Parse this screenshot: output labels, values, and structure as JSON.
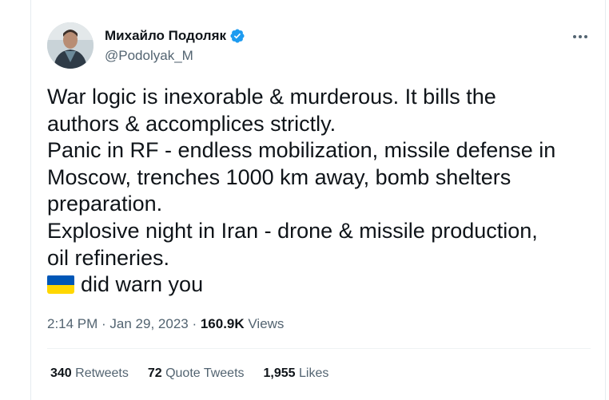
{
  "author": {
    "name": "Михайло Подоляк",
    "handle": "@Podolyak_M",
    "verified": true
  },
  "tweet": {
    "lines": [
      "War logic is inexorable & murderous. It bills the",
      "authors & accomplices strictly.",
      "Panic in RF - endless mobilization, missile defense in",
      "Moscow, trenches 1000 km away, bomb shelters",
      "preparation.",
      "Explosive night in Iran - drone & missile production,",
      "oil refineries.",
      "did warn you"
    ],
    "flag_icon": "ukraine-flag-emoji"
  },
  "meta": {
    "time": "2:14 PM",
    "dot1": " · ",
    "date": "Jan 29, 2023",
    "dot2": " · ",
    "views_count": "160.9K",
    "views_label": " Views"
  },
  "stats": {
    "retweets": {
      "count": "340",
      "label": " Retweets"
    },
    "quote_tweets": {
      "count": "72",
      "label": " Quote Tweets"
    },
    "likes": {
      "count": "1,955",
      "label": " Likes"
    }
  },
  "colors": {
    "text": "#0f1419",
    "secondary": "#536471",
    "verified": "#1d9bf0",
    "flag_blue": "#0057b7",
    "flag_yellow": "#ffd700"
  }
}
